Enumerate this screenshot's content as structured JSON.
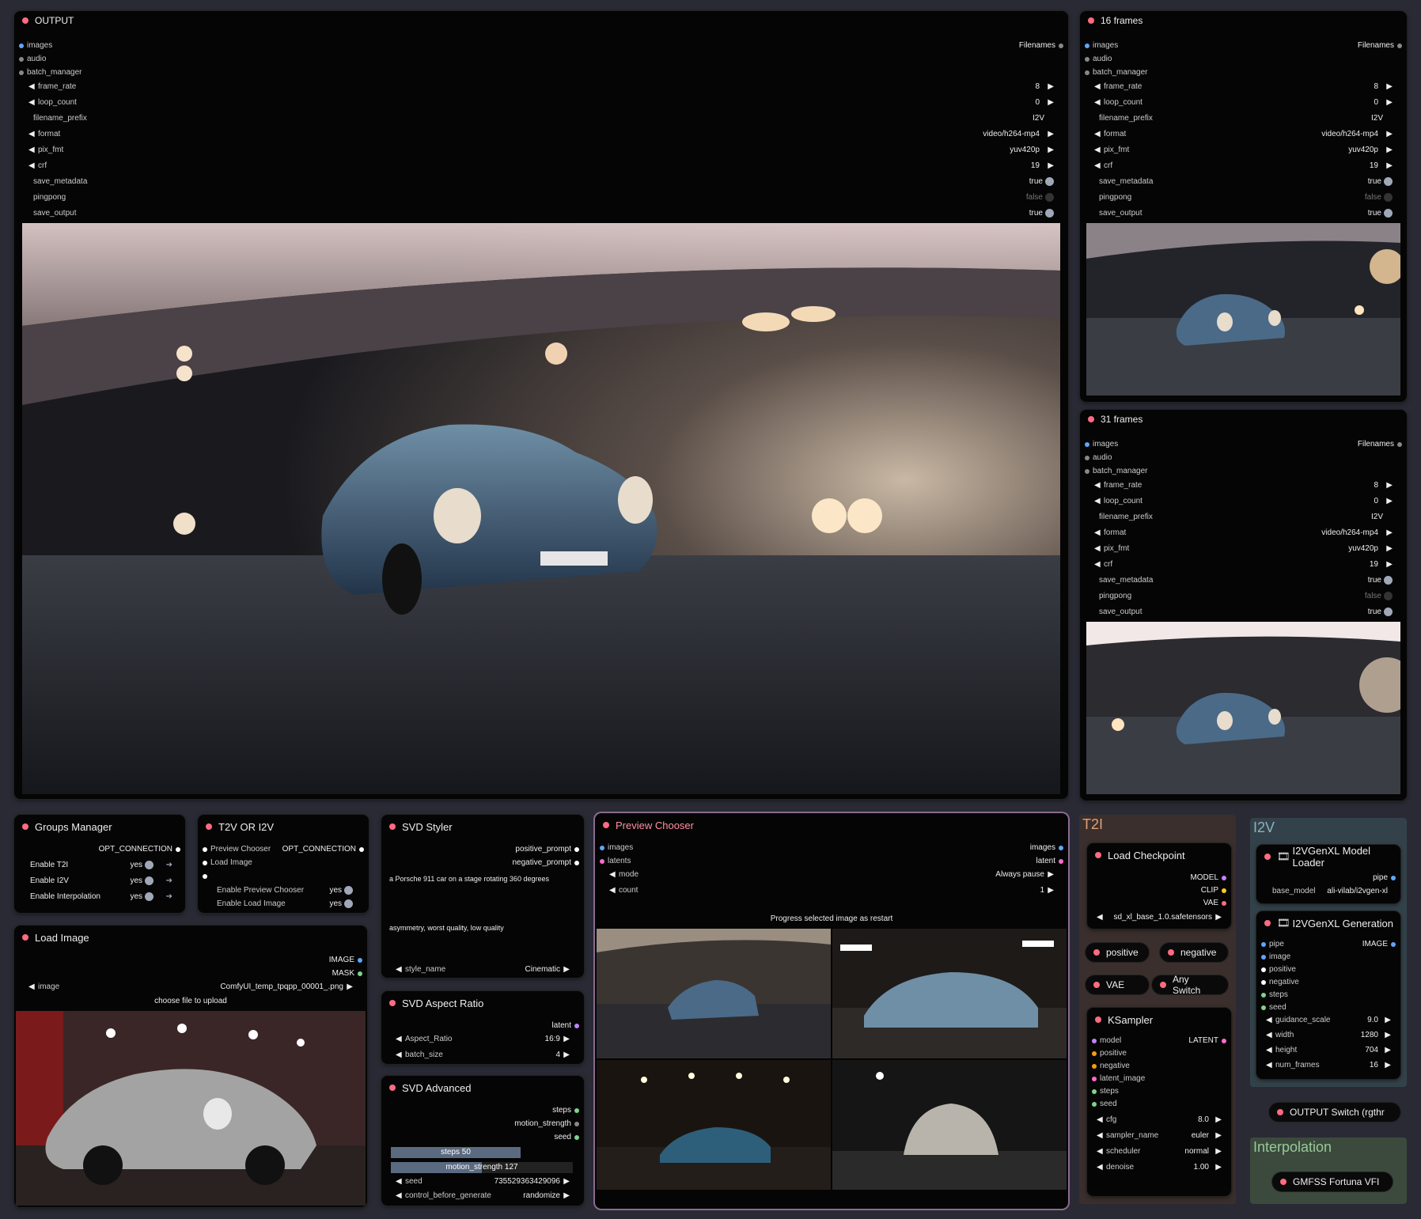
{
  "output_node": {
    "title": "OUTPUT",
    "inputs": [
      "images",
      "audio",
      "batch_manager"
    ],
    "output_label": "Filenames",
    "widgets": [
      {
        "name": "frame_rate",
        "value": "8",
        "arrow": true
      },
      {
        "name": "loop_count",
        "value": "0",
        "arrow": true
      },
      {
        "name": "filename_prefix",
        "value": "I2V",
        "arrow": false
      },
      {
        "name": "format",
        "value": "video/h264-mp4",
        "arrow": true
      },
      {
        "name": "pix_fmt",
        "value": "yuv420p",
        "arrow": true
      },
      {
        "name": "crf",
        "value": "19",
        "arrow": true
      },
      {
        "name": "save_metadata",
        "value": "true",
        "toggle": "on"
      },
      {
        "name": "pingpong",
        "value": "false",
        "toggle": "off"
      },
      {
        "name": "save_output",
        "value": "true",
        "toggle": "on"
      }
    ]
  },
  "frames16_node": {
    "title": "16 frames"
  },
  "frames31_node": {
    "title": "31 frames"
  },
  "groups_manager": {
    "title": "Groups Manager",
    "output": "OPT_CONNECTION",
    "items": [
      {
        "label": "Enable T2I",
        "value": "yes"
      },
      {
        "label": "Enable I2V",
        "value": "yes"
      },
      {
        "label": "Enable Interpolation",
        "value": "yes"
      }
    ]
  },
  "t2v_i2v": {
    "title": "T2V OR I2V",
    "inputs": [
      "Preview Chooser",
      "Load Image"
    ],
    "output": "OPT_CONNECTION",
    "widgets": [
      {
        "label": "Enable Preview Chooser",
        "value": "yes"
      },
      {
        "label": "Enable Load Image",
        "value": "yes"
      }
    ]
  },
  "svd_styler": {
    "title": "SVD Styler",
    "outputs": [
      "positive_prompt",
      "negative_prompt"
    ],
    "positive_text": "a Porsche 911 car on a stage rotating 360 degrees",
    "negative_text": "asymmetry, worst quality, low quality",
    "style_label": "style_name",
    "style_value": "Cinematic"
  },
  "svd_aspect": {
    "title": "SVD Aspect Ratio",
    "output": "latent",
    "widgets": [
      {
        "name": "Aspect_Ratio",
        "value": "16:9"
      },
      {
        "name": "batch_size",
        "value": "4"
      }
    ]
  },
  "svd_advanced": {
    "title": "SVD Advanced",
    "outputs": [
      "steps",
      "motion_strength",
      "seed"
    ],
    "steps_label": "steps",
    "steps_value": "50",
    "motion_label": "motion_strength",
    "motion_value": "127",
    "seed_label": "seed",
    "seed_value": "735529363429096",
    "control_label": "control_before_generate",
    "control_value": "randomize"
  },
  "load_image": {
    "title": "Load Image",
    "outputs": [
      "IMAGE",
      "MASK"
    ],
    "image_label": "image",
    "image_value": "ComfyUI_temp_tpqpp_00001_.png",
    "upload": "choose file to upload"
  },
  "preview_chooser": {
    "title": "Preview Chooser",
    "inputs": [
      "images",
      "latents"
    ],
    "outputs": [
      "images",
      "latent"
    ],
    "mode_label": "mode",
    "mode_value": "Always pause",
    "count_label": "count",
    "count_value": "1",
    "progress": "Progress selected image as restart"
  },
  "t2i_group": {
    "title": "T2I",
    "checkpoint_title": "Load Checkpoint",
    "checkpoint_outputs": [
      "MODEL",
      "CLIP",
      "VAE"
    ],
    "checkpoint_value": "sd_xl_base_1.0.safetensors",
    "chips": [
      "positive",
      "negative",
      "VAE",
      "Any Switch"
    ],
    "ksampler_title": "KSampler",
    "ksampler_inputs": [
      "model",
      "positive",
      "negative",
      "latent_image",
      "steps",
      "seed"
    ],
    "ksampler_output": "LATENT",
    "ksampler_widgets": [
      {
        "name": "cfg",
        "value": "8.0"
      },
      {
        "name": "sampler_name",
        "value": "euler"
      },
      {
        "name": "scheduler",
        "value": "normal"
      },
      {
        "name": "denoise",
        "value": "1.00"
      }
    ]
  },
  "i2v_group": {
    "title": "I2V",
    "loader_title": "I2VGenXL Model Loader",
    "loader_output": "pipe",
    "loader_base_label": "base_model",
    "loader_base_value": "ali-vilab/i2vgen-xl",
    "gen_title": "I2VGenXL Generation",
    "gen_inputs": [
      "pipe",
      "image",
      "positive",
      "negative",
      "steps",
      "seed"
    ],
    "gen_output": "IMAGE",
    "gen_widgets": [
      {
        "name": "guidance_scale",
        "value": "9.0"
      },
      {
        "name": "width",
        "value": "1280"
      },
      {
        "name": "height",
        "value": "704"
      },
      {
        "name": "num_frames",
        "value": "16"
      }
    ]
  },
  "output_switch": {
    "label": "OUTPUT Switch (rgthr"
  },
  "interpolation_group": {
    "title": "Interpolation",
    "node": "GMFSS Fortuna VFI"
  },
  "colors": {
    "bg": "#2a2a35",
    "node": "#050505",
    "accent": "#ff6b81",
    "selected": "#7ed48a"
  }
}
